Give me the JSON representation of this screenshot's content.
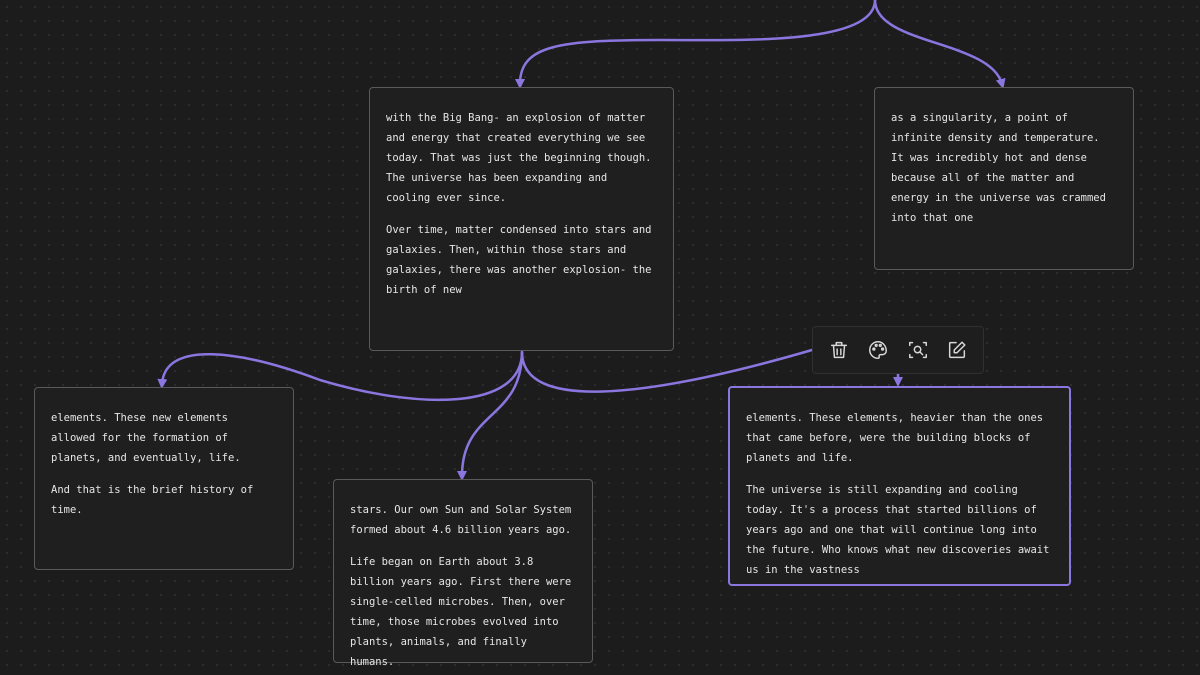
{
  "canvas": {
    "accent_color": "#8b76e0",
    "background_color": "#1c1c1c",
    "card_border_color": "#5a5a5a"
  },
  "toolbar": {
    "tools": [
      {
        "icon": "trash-icon",
        "action": "delete"
      },
      {
        "icon": "palette-icon",
        "action": "color"
      },
      {
        "icon": "zoom-to-fit-icon",
        "action": "zoom"
      },
      {
        "icon": "edit-icon",
        "action": "edit"
      }
    ]
  },
  "cards": {
    "big_bang": {
      "p1": "with the Big Bang- an explosion of matter and energy that created everything we see today. That was just the beginning though. The universe has been expanding and cooling ever since.",
      "p2": "Over time, matter condensed into stars and galaxies. Then, within those stars and galaxies, there was another explosion- the birth of new"
    },
    "singularity": {
      "p1": "as a singularity, a point of infinite density and temperature. It was incredibly hot and dense because all of the matter and energy in the universe was crammed into that one"
    },
    "elements_life": {
      "p1": "elements. These new elements allowed for the formation of planets, and eventually, life.",
      "p2": "And that is the brief history of time."
    },
    "stars_sun": {
      "p1": "stars. Our own Sun and Solar System formed about 4.6 billion years ago.",
      "p2": "Life began on Earth about 3.8 billion years ago. First there were single-celled microbes. Then, over time, those microbes evolved into plants, animals, and finally humans."
    },
    "elements_heavier": {
      "p1": "elements. These elements, heavier than the ones that came before, were the building blocks of planets and life.",
      "p2": "The universe is still expanding and cooling today. It's a process that started billions of years ago and one that will continue long into the future. Who knows what new discoveries await us in the vastness"
    }
  }
}
